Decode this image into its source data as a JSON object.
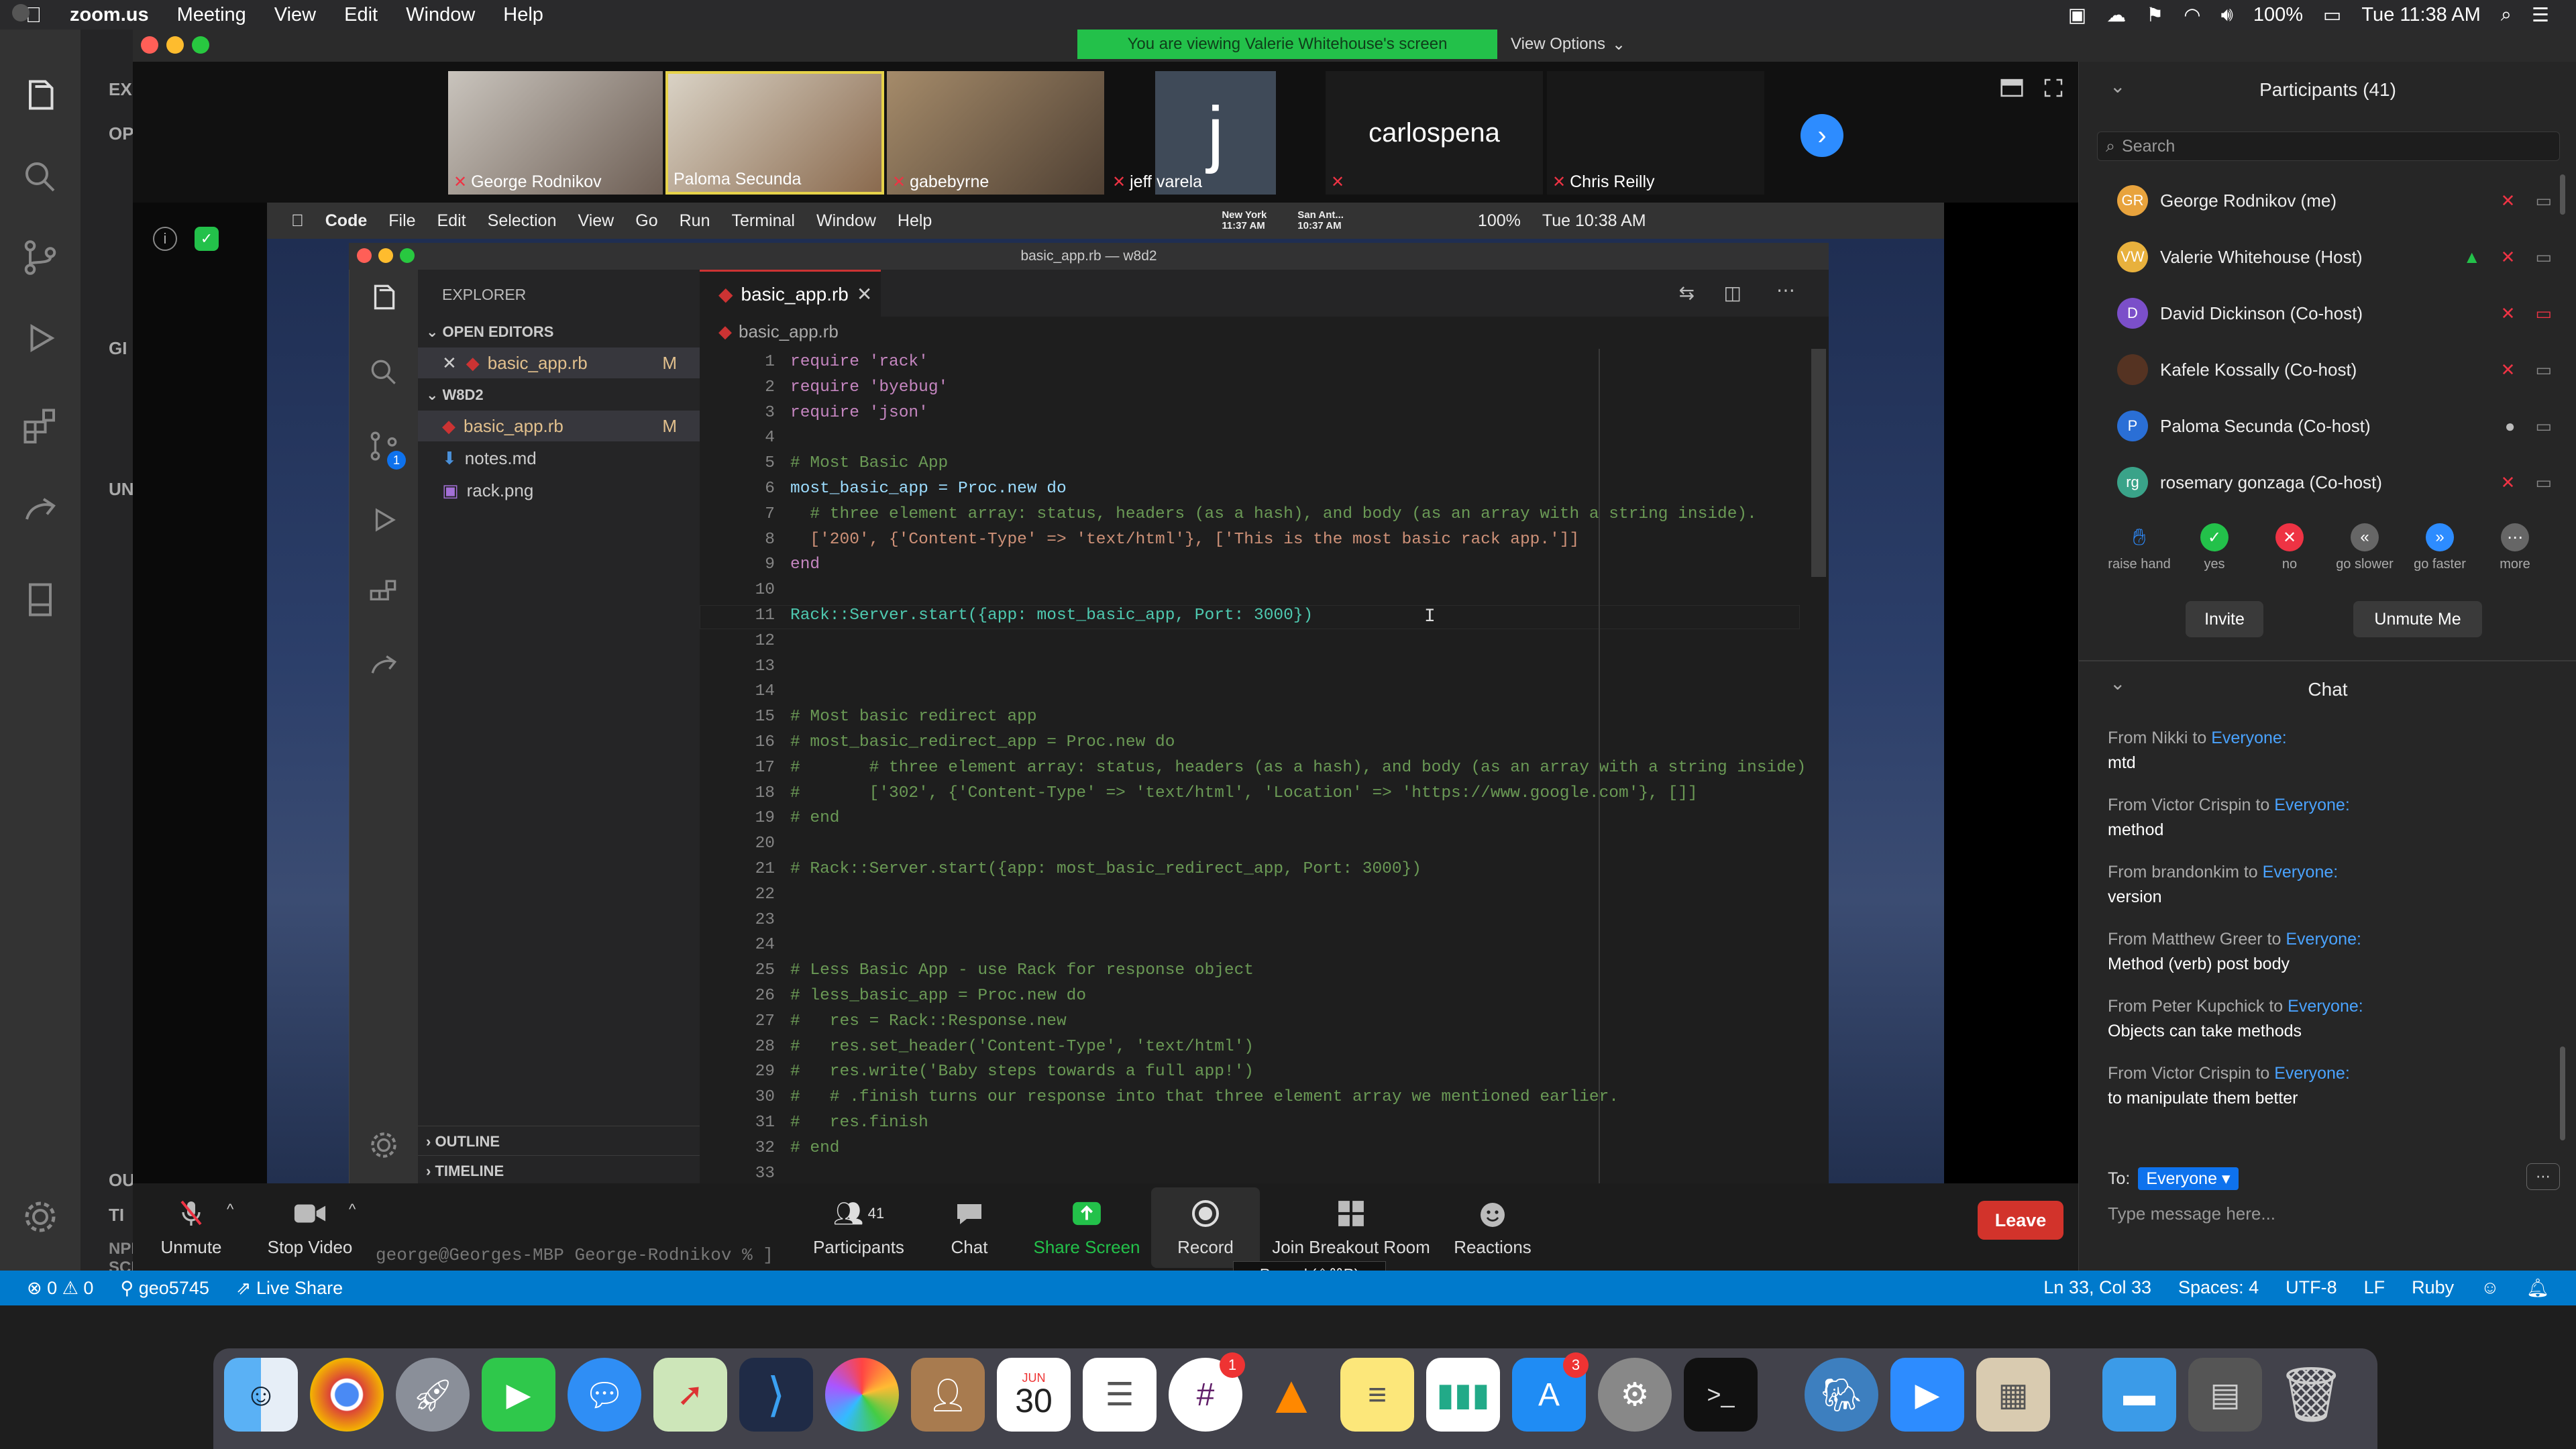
{
  "menubar": {
    "app": "zoom.us",
    "items": [
      "Meeting",
      "View",
      "Edit",
      "Window",
      "Help"
    ],
    "battery": "100%",
    "clock": "Tue 11:38 AM"
  },
  "background_vscode": {
    "sidebar_fragments": [
      "EX",
      "OP",
      "GI",
      "UN",
      "OU",
      "TI",
      "NPM SCRIPTS"
    ],
    "terminal_line": "george@Georges-MBP George-Rodnikov % ]"
  },
  "zoom": {
    "banner": "You are viewing Valerie Whitehouse's screen",
    "view_options": "View Options",
    "tiles": [
      {
        "name": "George Rodnikov",
        "muted": true
      },
      {
        "name": "Paloma Secunda",
        "muted": false
      },
      {
        "name": "gabebyrne",
        "muted": true
      },
      {
        "name": "jeff varela",
        "muted": true,
        "initial": "j"
      },
      {
        "name": "carlospena",
        "muted": true
      },
      {
        "name": "Chris Reilly",
        "muted": true
      }
    ],
    "toolbar": {
      "unmute": "Unmute",
      "stop_video": "Stop Video",
      "participants": "Participants",
      "participants_count": "41",
      "chat": "Chat",
      "share_screen": "Share Screen",
      "record": "Record",
      "breakout": "Join Breakout Room",
      "reactions": "Reactions",
      "leave": "Leave",
      "record_tooltip": "Record (⇧⌘R)"
    },
    "colors": {
      "accent": "#2d8cff",
      "share_green": "#23c14a",
      "leave_red": "#d2332b"
    }
  },
  "shared": {
    "menubar": {
      "app": "Code",
      "items": [
        "File",
        "Edit",
        "Selection",
        "View",
        "Go",
        "Run",
        "Terminal",
        "Window",
        "Help"
      ],
      "city1": "New York",
      "time1": "11:37 AM",
      "city2": "San Ant...",
      "time2": "10:37 AM",
      "battery": "100%",
      "clock": "Tue 10:38 AM"
    },
    "vscode": {
      "window_title": "basic_app.rb — w8d2",
      "explorer_title": "EXPLORER",
      "open_editors": "OPEN EDITORS",
      "open_file": "basic_app.rb",
      "open_file_status": "M",
      "folder": "W8D2",
      "files": [
        {
          "name": "basic_app.rb",
          "status": "M"
        },
        {
          "name": "notes.md",
          "status": ""
        },
        {
          "name": "rack.png",
          "status": ""
        }
      ],
      "outline": "OUTLINE",
      "timeline": "TIMELINE",
      "scm_badge": "1",
      "tab": "basic_app.rb",
      "breadcrumb": "basic_app.rb",
      "code": [
        {
          "n": "1",
          "t": "require 'rack'"
        },
        {
          "n": "2",
          "t": "require 'byebug'"
        },
        {
          "n": "3",
          "t": "require 'json'"
        },
        {
          "n": "4",
          "t": ""
        },
        {
          "n": "5",
          "t": "# Most Basic App"
        },
        {
          "n": "6",
          "t": "most_basic_app = Proc.new do"
        },
        {
          "n": "7",
          "t": "  # three element array: status, headers (as a hash), and body (as an array with a string inside)."
        },
        {
          "n": "8",
          "t": "  ['200', {'Content-Type' => 'text/html'}, ['This is the most basic rack app.']]"
        },
        {
          "n": "9",
          "t": "end"
        },
        {
          "n": "10",
          "t": ""
        },
        {
          "n": "11",
          "t": "Rack::Server.start({app: most_basic_app, Port: 3000})"
        },
        {
          "n": "12",
          "t": ""
        },
        {
          "n": "13",
          "t": ""
        },
        {
          "n": "14",
          "t": ""
        },
        {
          "n": "15",
          "t": "# Most basic redirect app"
        },
        {
          "n": "16",
          "t": "# most_basic_redirect_app = Proc.new do"
        },
        {
          "n": "17",
          "t": "#       # three element array: status, headers (as a hash), and body (as an array with a string inside)"
        },
        {
          "n": "18",
          "t": "#       ['302', {'Content-Type' => 'text/html', 'Location' => 'https://www.google.com'}, []]"
        },
        {
          "n": "19",
          "t": "# end"
        },
        {
          "n": "20",
          "t": ""
        },
        {
          "n": "21",
          "t": "# Rack::Server.start({app: most_basic_redirect_app, Port: 3000})"
        },
        {
          "n": "22",
          "t": ""
        },
        {
          "n": "23",
          "t": ""
        },
        {
          "n": "24",
          "t": ""
        },
        {
          "n": "25",
          "t": "# Less Basic App - use Rack for response object"
        },
        {
          "n": "26",
          "t": "# less_basic_app = Proc.new do"
        },
        {
          "n": "27",
          "t": "#   res = Rack::Response.new"
        },
        {
          "n": "28",
          "t": "#   res.set_header('Content-Type', 'text/html')"
        },
        {
          "n": "29",
          "t": "#   res.write('Baby steps towards a full app!')"
        },
        {
          "n": "30",
          "t": "#   # .finish turns our response into that three element array we mentioned earlier."
        },
        {
          "n": "31",
          "t": "#   res.finish"
        },
        {
          "n": "32",
          "t": "# end"
        },
        {
          "n": "33",
          "t": ""
        }
      ]
    }
  },
  "participants": {
    "title": "Participants (41)",
    "search_placeholder": "Search",
    "list": [
      {
        "name": "George Rodnikov (me)",
        "initials": "GR",
        "color": "#e8a33d"
      },
      {
        "name": "Valerie Whitehouse (Host)",
        "initials": "VW",
        "color": "#e8b13d"
      },
      {
        "name": "David Dickinson (Co-host)",
        "initials": "D",
        "color": "#7b4fc9"
      },
      {
        "name": "Kafele Kossally (Co-host)",
        "initials": "",
        "color": "#553322"
      },
      {
        "name": "Paloma Secunda (Co-host)",
        "initials": "P",
        "color": "#2a6fd6"
      },
      {
        "name": "rosemary gonzaga (Co-host)",
        "initials": "rg",
        "color": "#3aa389"
      }
    ],
    "reactions": [
      "raise hand",
      "yes",
      "no",
      "go slower",
      "go faster",
      "more"
    ],
    "invite": "Invite",
    "unmute_me": "Unmute Me"
  },
  "chat": {
    "title": "Chat",
    "messages": [
      {
        "from": "From Nikki to ",
        "to": "Everyone:",
        "text": "mtd"
      },
      {
        "from": "From Victor Crispin to ",
        "to": "Everyone:",
        "text": "method"
      },
      {
        "from": "From brandonkim to ",
        "to": "Everyone:",
        "text": "version"
      },
      {
        "from": "From Matthew Greer to ",
        "to": "Everyone:",
        "text": "Method (verb) post body"
      },
      {
        "from": "From Peter Kupchick to ",
        "to": "Everyone:",
        "text": "Objects can take methods"
      },
      {
        "from": "From Victor Crispin to ",
        "to": "Everyone:",
        "text": "to manipulate them better"
      }
    ],
    "to_label": "To:",
    "to_value": "Everyone",
    "input_placeholder": "Type message here..."
  },
  "statusbar": {
    "errors": "0",
    "warnings": "0",
    "user": "geo5745",
    "live_share": "Live Share",
    "position": "Ln 33, Col 33",
    "spaces": "Spaces: 4",
    "encoding": "UTF-8",
    "eol": "LF",
    "language": "Ruby"
  },
  "dock": {
    "calendar_month": "JUN",
    "calendar_day": "30",
    "slack_badge": "1",
    "appstore_badge": "3"
  }
}
